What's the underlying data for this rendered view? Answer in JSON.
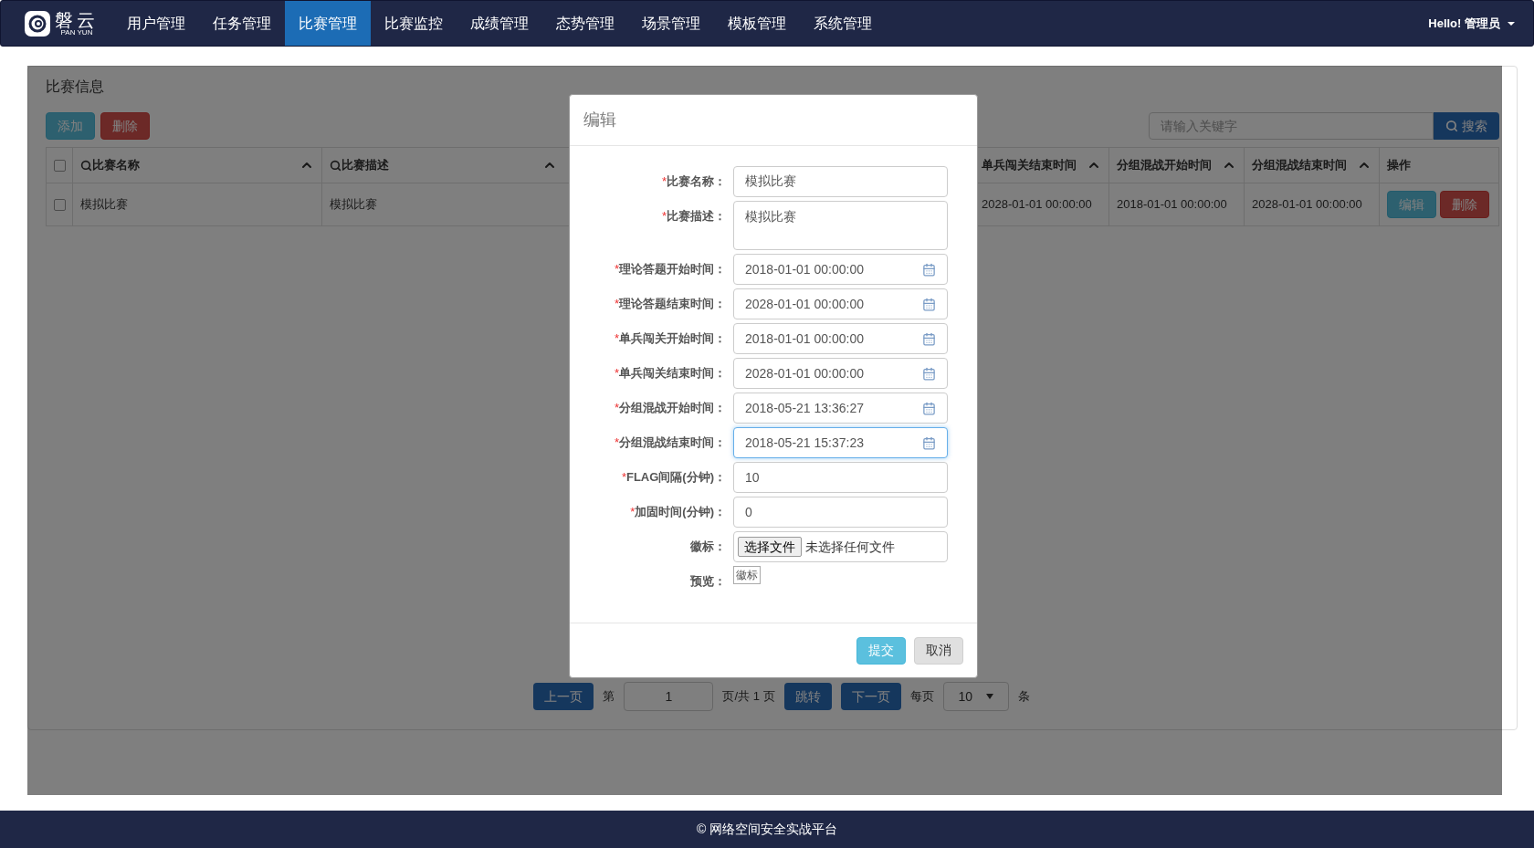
{
  "nav": {
    "logo": {
      "text": "磐云",
      "subtext": "PAN YUN"
    },
    "items": [
      {
        "label": "用户管理",
        "selected": false
      },
      {
        "label": "任务管理",
        "selected": false
      },
      {
        "label": "比赛管理",
        "selected": true
      },
      {
        "label": "比赛监控",
        "selected": false
      },
      {
        "label": "成绩管理",
        "selected": false
      },
      {
        "label": "态势管理",
        "selected": false
      },
      {
        "label": "场景管理",
        "selected": false
      },
      {
        "label": "模板管理",
        "selected": false
      },
      {
        "label": "系统管理",
        "selected": false
      }
    ],
    "user": "Hello! 管理员"
  },
  "panel": {
    "title": "比赛信息",
    "buttons": [
      {
        "label": "添加",
        "kind": "info"
      },
      {
        "label": "删除",
        "kind": "danger"
      }
    ],
    "search": {
      "placeholder": "请输入关键字",
      "button": "搜索"
    }
  },
  "table": {
    "header_checked": false,
    "columns": [
      {
        "label": "比赛名称",
        "searchable": true,
        "sortable": true
      },
      {
        "label": "比赛描述",
        "searchable": true,
        "sortable": true
      },
      {
        "label": "单兵闯关结束时间",
        "searchable": false,
        "sortable": true
      },
      {
        "label": "分组混战开始时间",
        "searchable": false,
        "sortable": true
      },
      {
        "label": "分组混战结束时间",
        "searchable": false,
        "sortable": true
      },
      {
        "label": "操作",
        "searchable": false,
        "sortable": false
      }
    ],
    "rows": [
      {
        "checked": false,
        "cells": [
          "模拟比赛",
          "模拟比赛",
          "2028-01-01 00:00:00",
          "2018-01-01 00:00:00",
          "2028-01-01 00:00:00"
        ],
        "actions": [
          {
            "label": "编辑",
            "kind": "info"
          },
          {
            "label": "删除",
            "kind": "danger"
          }
        ]
      }
    ]
  },
  "pagination": {
    "prev": "上一页",
    "page_prefix": "第",
    "page_value": "1",
    "page_suffix": "页/共 1 页",
    "jump": "跳转",
    "next": "下一页",
    "per_page_prefix": "每页",
    "per_page_value": "10",
    "per_page_suffix": "条"
  },
  "modal": {
    "title": "编辑",
    "fields": [
      {
        "mark": "*",
        "label": "比赛名称：",
        "kind": "text",
        "value": "模拟比赛",
        "focused": false
      },
      {
        "mark": "*",
        "label": "比赛描述：",
        "kind": "textarea",
        "value": "模拟比赛",
        "focused": false
      },
      {
        "mark": "*",
        "label": "理论答题开始时间：",
        "kind": "date",
        "value": "2018-01-01 00:00:00",
        "focused": false
      },
      {
        "mark": "*",
        "label": "理论答题结束时间：",
        "kind": "date",
        "value": "2028-01-01 00:00:00",
        "focused": false
      },
      {
        "mark": "*",
        "label": "单兵闯关开始时间：",
        "kind": "date",
        "value": "2018-01-01 00:00:00",
        "focused": false
      },
      {
        "mark": "*",
        "label": "单兵闯关结束时间：",
        "kind": "date",
        "value": "2028-01-01 00:00:00",
        "focused": false
      },
      {
        "mark": "*",
        "label": "分组混战开始时间：",
        "kind": "date",
        "value": "2018-05-21 13:36:27",
        "focused": false
      },
      {
        "mark": "*",
        "label": "分组混战结束时间：",
        "kind": "date",
        "value": "2018-05-21 15:37:23",
        "focused": true
      },
      {
        "mark": "*",
        "label": "FLAG间隔(分钟)：",
        "kind": "text",
        "value": "10",
        "focused": false
      },
      {
        "mark": "*",
        "label": "加固时间(分钟)：",
        "kind": "text",
        "value": "0",
        "focused": false
      },
      {
        "label": "徽标：",
        "kind": "file",
        "button": "选择文件",
        "value": "未选择任何文件"
      },
      {
        "label": "预览：",
        "kind": "preview",
        "value": "徽标"
      }
    ],
    "buttons": [
      {
        "label": "提交",
        "kind": "primary"
      },
      {
        "label": "取消",
        "kind": "default"
      }
    ]
  },
  "footer": {
    "text": "© 网络空间安全实战平台"
  }
}
